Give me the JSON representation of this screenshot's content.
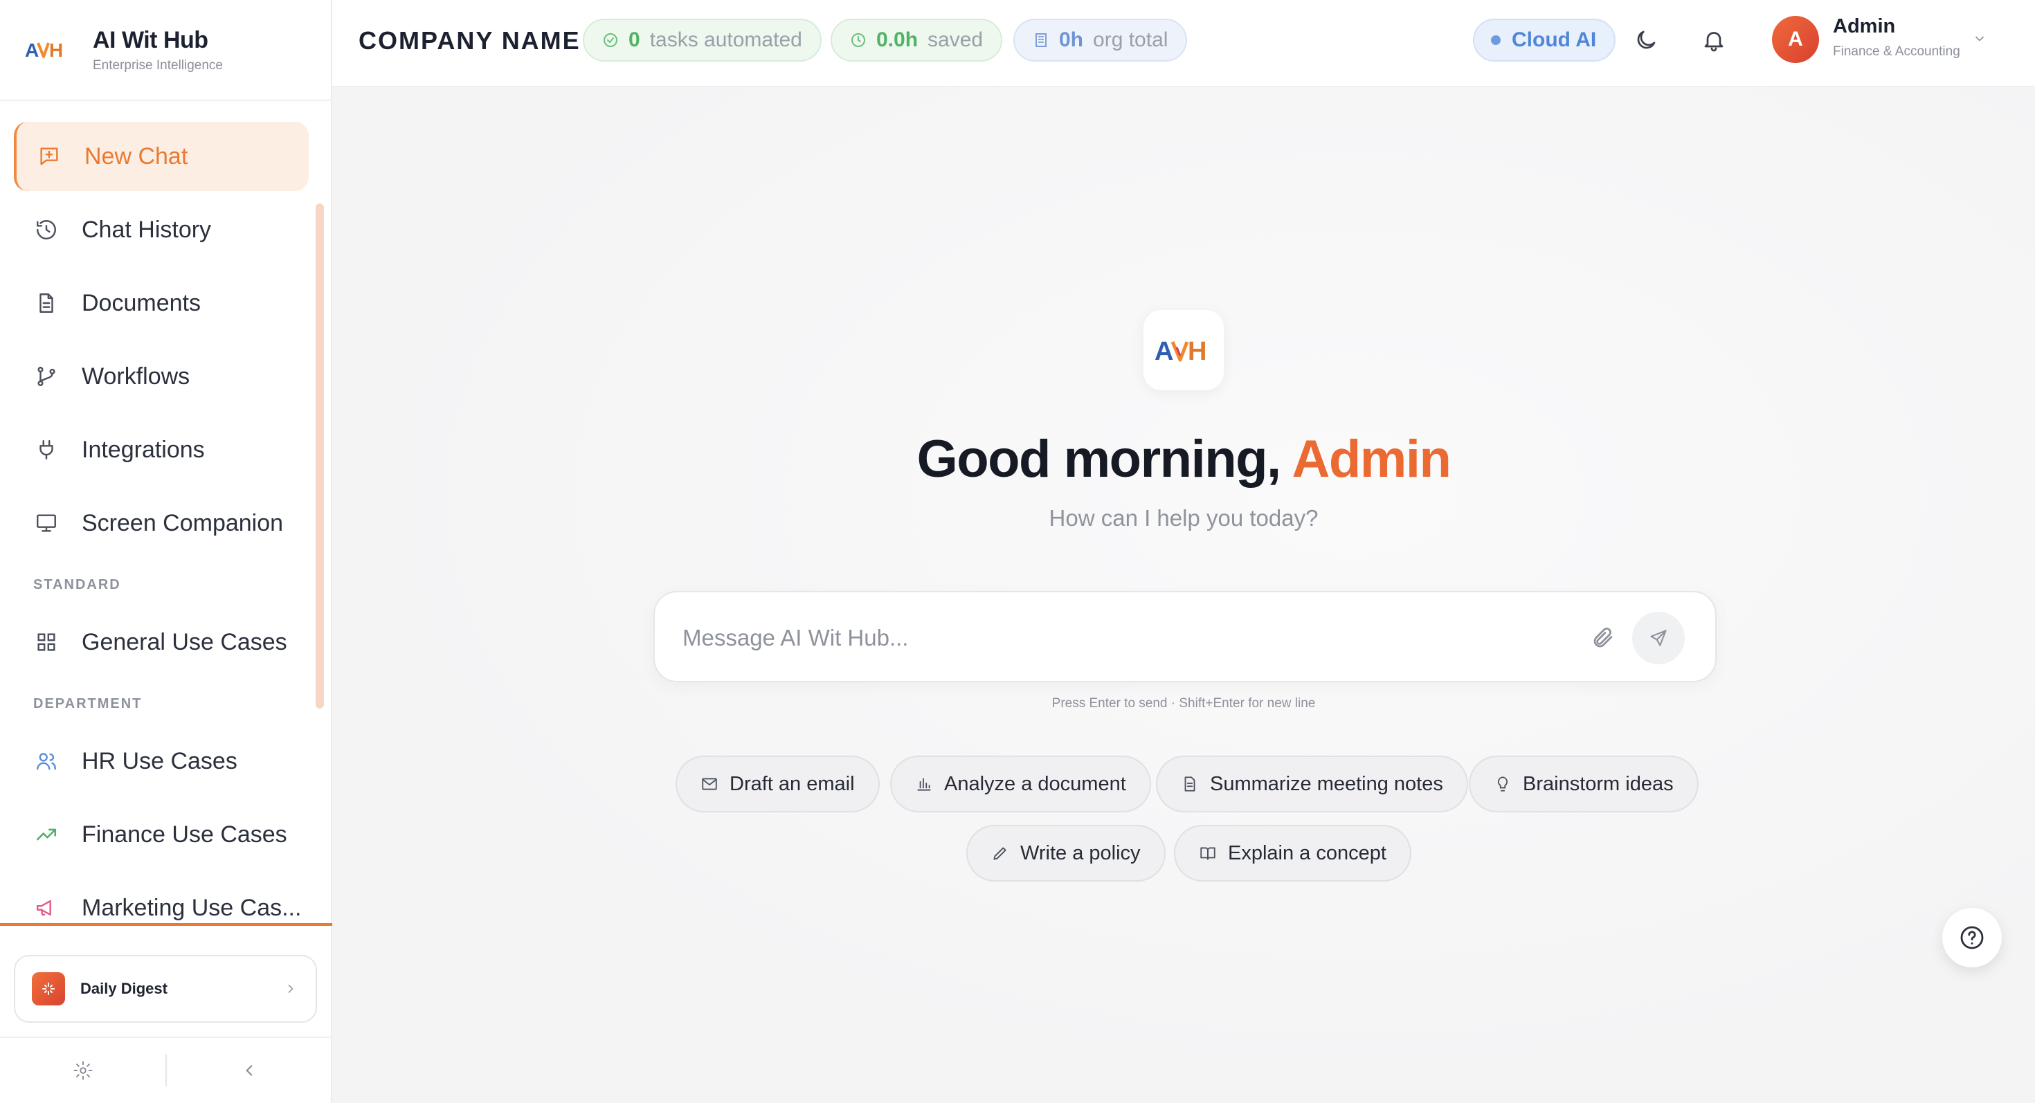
{
  "app": {
    "name": "AI Wit Hub",
    "tagline": "Enterprise Intelligence"
  },
  "sidebar": {
    "items": [
      {
        "label": "New Chat",
        "icon": "message-plus-icon",
        "active": true
      },
      {
        "label": "Chat History",
        "icon": "history-icon"
      },
      {
        "label": "Documents",
        "icon": "document-icon"
      },
      {
        "label": "Workflows",
        "icon": "git-branch-icon"
      },
      {
        "label": "Integrations",
        "icon": "plug-icon"
      },
      {
        "label": "Screen Companion",
        "icon": "monitor-icon"
      }
    ],
    "sections": [
      {
        "title": "STANDARD",
        "items": [
          {
            "label": "General Use Cases",
            "icon": "grid-icon"
          }
        ]
      },
      {
        "title": "DEPARTMENT",
        "items": [
          {
            "label": "HR Use Cases",
            "icon": "users-icon"
          },
          {
            "label": "Finance Use Cases",
            "icon": "trending-up-icon"
          },
          {
            "label": "Marketing Use Cas...",
            "icon": "megaphone-icon"
          }
        ]
      }
    ],
    "digest": {
      "label": "Daily Digest",
      "icon": "sparkle-icon"
    },
    "footer": {
      "settings_icon": "gear-icon",
      "collapse_icon": "chevron-left-icon"
    }
  },
  "header": {
    "company": "COMPANY NAME",
    "stats": [
      {
        "value": "0",
        "label": "tasks automated",
        "icon": "check-circle-icon"
      },
      {
        "value": "0.0h",
        "label": "saved",
        "icon": "clock-icon"
      },
      {
        "value": "0h",
        "label": "org total",
        "icon": "building-icon"
      }
    ],
    "mode": "Cloud AI",
    "theme_icon": "moon-icon",
    "notifications_icon": "bell-icon",
    "user": {
      "initial": "A",
      "name": "Admin",
      "role": "Finance & Accounting"
    }
  },
  "main": {
    "greeting_prefix": "Good morning, ",
    "greeting_name": "Admin",
    "subtitle": "How can I help you today?",
    "composer": {
      "placeholder": "Message AI Wit Hub...",
      "value": ""
    },
    "hint": "Press Enter to send · Shift+Enter for new line",
    "suggestions": [
      {
        "label": "Draft an email",
        "icon": "mail-icon"
      },
      {
        "label": "Analyze a document",
        "icon": "bar-chart-icon"
      },
      {
        "label": "Summarize meeting notes",
        "icon": "file-text-icon"
      },
      {
        "label": "Brainstorm ideas",
        "icon": "lightbulb-icon"
      },
      {
        "label": "Write a policy",
        "icon": "pencil-icon"
      },
      {
        "label": "Explain a concept",
        "icon": "book-open-icon"
      }
    ]
  },
  "colors": {
    "accent": "#ea6a31",
    "active_bg": "#fdeee3",
    "cloud_blue": "#4f86d8",
    "stat_green": "#52b266"
  }
}
